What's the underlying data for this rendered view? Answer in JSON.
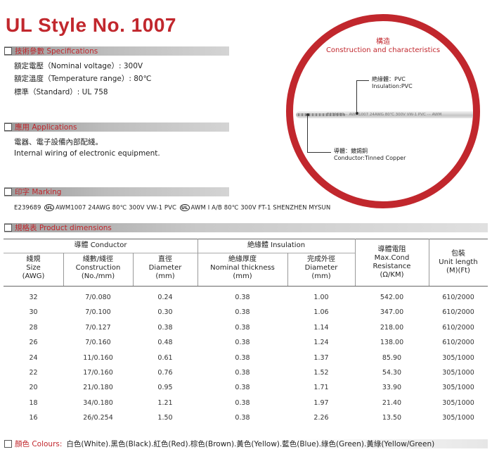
{
  "title": "UL Style No. 1007",
  "specifications": {
    "heading": "技術參數 Specifications",
    "lines": [
      "額定電壓（Nominal voltage）: 300V",
      "額定溫度（Temperature range）: 80℃",
      "標準（Standard）: UL 758"
    ]
  },
  "applications": {
    "heading": "應用 Applications",
    "lines": [
      "電器、電子設備內部配綫。",
      "Internal wiring of electronic equipment."
    ]
  },
  "marking": {
    "heading": "印字 Marking",
    "part1": "E239689",
    "part2": "AWM1007 24AWG 80℃ 300V VW-1 PVC",
    "part3": "AWM I A/B 80℃ 300V FT-1 SHENZHEN MYSUN",
    "ul_symbol": "UL"
  },
  "construction": {
    "title_cn": "構造",
    "title_en": "Construction  and  characteristics",
    "cable_print": "E239689 ·· AWM1007 24AWG 80℃ 300V VW-1 PVC ··· AWM",
    "insulation": [
      "絶緣體：PVC",
      "Insulation:PVC"
    ],
    "conductor": [
      "導體：鍍錫銅",
      "Conductor:Tinned Copper"
    ]
  },
  "dimensions": {
    "heading": "規格表 Product  dimensions",
    "group_conductor": "導體 Conductor",
    "group_insulation": "絶緣體 Insulation",
    "headers": [
      "綫規\nSize\n(AWG)",
      "綫數/綫徑\nConstruction\n(No./mm)",
      "直徑\nDiameter\n(mm)",
      "絶緣厚度\nNominal thickness\n(mm)",
      "完成外徑\nDiameter\n(mm)",
      "導體電阻\nMax.Cond\nResistance\n(Ω/KM)",
      "包裝\nUnit length\n(M)(Ft)"
    ],
    "rows": [
      [
        "32",
        "7/0.080",
        "0.24",
        "0.38",
        "1.00",
        "542.00",
        "610/2000"
      ],
      [
        "30",
        "7/0.100",
        "0.30",
        "0.38",
        "1.06",
        "347.00",
        "610/2000"
      ],
      [
        "28",
        "7/0.127",
        "0.38",
        "0.38",
        "1.14",
        "218.00",
        "610/2000"
      ],
      [
        "26",
        "7/0.160",
        "0.48",
        "0.38",
        "1.24",
        "138.00",
        "610/2000"
      ],
      [
        "24",
        "11/0.160",
        "0.61",
        "0.38",
        "1.37",
        "85.90",
        "305/1000"
      ],
      [
        "22",
        "17/0.160",
        "0.76",
        "0.38",
        "1.52",
        "54.30",
        "305/1000"
      ],
      [
        "20",
        "21/0.180",
        "0.95",
        "0.38",
        "1.71",
        "33.90",
        "305/1000"
      ],
      [
        "18",
        "34/0.180",
        "1.21",
        "0.38",
        "1.97",
        "21.40",
        "305/1000"
      ],
      [
        "16",
        "26/0.254",
        "1.50",
        "0.38",
        "2.26",
        "13.50",
        "305/1000"
      ]
    ]
  },
  "colours": {
    "label": "顏色 Colours:",
    "value": "白色(White).黑色(Black).紅色(Red).棕色(Brown).黃色(Yellow).藍色(Blue).綠色(Green).黃綠(Yellow/Green)"
  }
}
